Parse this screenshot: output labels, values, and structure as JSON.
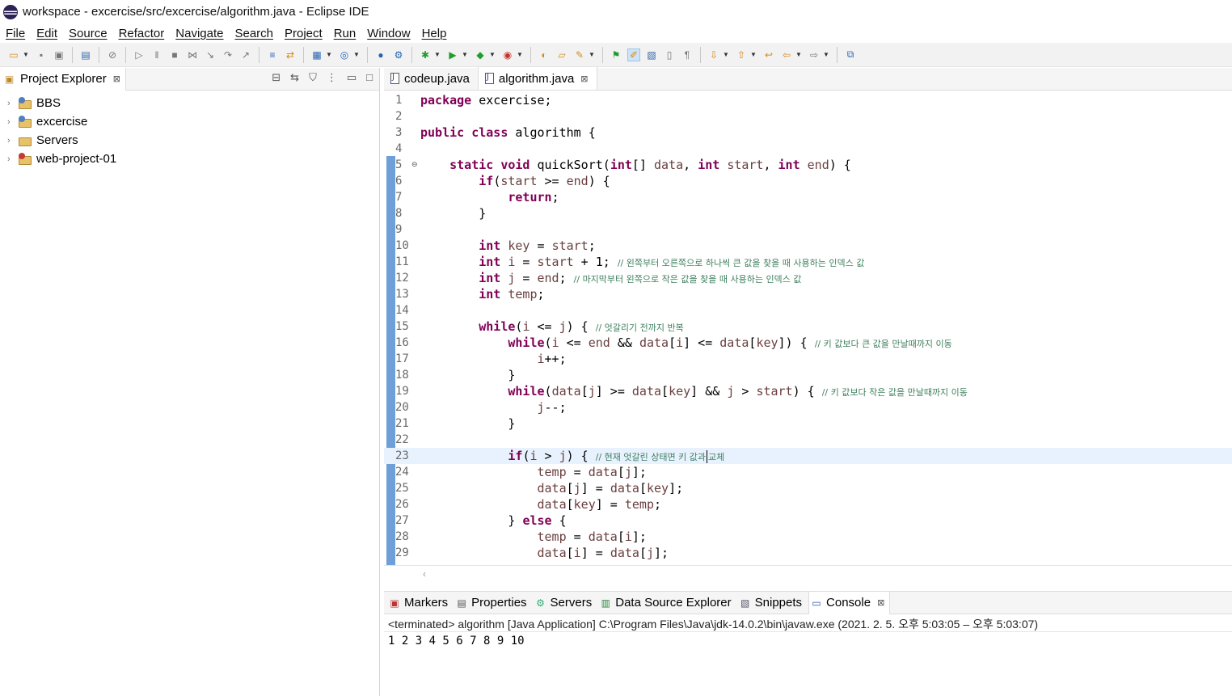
{
  "window": {
    "title": "workspace - excercise/src/excercise/algorithm.java - Eclipse IDE"
  },
  "menu": [
    "File",
    "Edit",
    "Source",
    "Refactor",
    "Navigate",
    "Search",
    "Project",
    "Run",
    "Window",
    "Help"
  ],
  "explorer": {
    "title": "Project Explorer",
    "close": "⊠",
    "projects": [
      {
        "label": "BBS",
        "badge": "java"
      },
      {
        "label": "excercise",
        "badge": "java"
      },
      {
        "label": "Servers",
        "badge": "folder"
      },
      {
        "label": "web-project-01",
        "badge": "web"
      }
    ]
  },
  "editor": {
    "tabs": [
      {
        "label": "codeup.java",
        "active": false
      },
      {
        "label": "algorithm.java",
        "active": true,
        "close": "⊠"
      }
    ],
    "current_line": 23,
    "lines": [
      {
        "n": "1",
        "fold": ""
      },
      {
        "n": "2",
        "fold": ""
      },
      {
        "n": "3",
        "fold": ""
      },
      {
        "n": "4",
        "fold": ""
      },
      {
        "n": "5",
        "fold": "⊖"
      },
      {
        "n": "6",
        "fold": ""
      },
      {
        "n": "7",
        "fold": ""
      },
      {
        "n": "8",
        "fold": ""
      },
      {
        "n": "9",
        "fold": ""
      },
      {
        "n": "10",
        "fold": ""
      },
      {
        "n": "11",
        "fold": ""
      },
      {
        "n": "12",
        "fold": ""
      },
      {
        "n": "13",
        "fold": ""
      },
      {
        "n": "14",
        "fold": ""
      },
      {
        "n": "15",
        "fold": ""
      },
      {
        "n": "16",
        "fold": ""
      },
      {
        "n": "17",
        "fold": ""
      },
      {
        "n": "18",
        "fold": ""
      },
      {
        "n": "19",
        "fold": ""
      },
      {
        "n": "20",
        "fold": ""
      },
      {
        "n": "21",
        "fold": ""
      },
      {
        "n": "22",
        "fold": ""
      },
      {
        "n": "23",
        "fold": ""
      },
      {
        "n": "24",
        "fold": ""
      },
      {
        "n": "25",
        "fold": ""
      },
      {
        "n": "26",
        "fold": ""
      },
      {
        "n": "27",
        "fold": ""
      },
      {
        "n": "28",
        "fold": ""
      },
      {
        "n": "29",
        "fold": ""
      }
    ],
    "code": {
      "l1_kw": "package",
      "l1_rest": " excercise;",
      "l3_kw1": "public",
      "l3_kw2": "class",
      "l3_rest": " algorithm {",
      "l5_kw1": "static",
      "l5_kw2": "void",
      "l5_m": " quickSort(",
      "l5_kw3": "int",
      "l5_a": "[] ",
      "l5_v1": "data",
      "l5_b": ", ",
      "l5_kw4": "int",
      "l5_c": " ",
      "l5_v2": "start",
      "l5_d": ", ",
      "l5_kw5": "int",
      "l5_e": " ",
      "l5_v3": "end",
      "l5_f": ") {",
      "l6_kw": "if",
      "l6_a": "(",
      "l6_v1": "start",
      "l6_b": " >= ",
      "l6_v2": "end",
      "l6_c": ") {",
      "l7_kw": "return",
      "l7_a": ";",
      "l8": "}",
      "l10_kw": "int",
      "l10_v1": " key",
      "l10_a": " = ",
      "l10_v2": "start",
      "l10_b": ";",
      "l11_kw": "int",
      "l11_v1": " i",
      "l11_a": " = ",
      "l11_v2": "start",
      "l11_b": " + 1; ",
      "l11_cm": "// 왼쪽부터 오른쪽으로 하나씩 큰 값을 찾을 때 사용하는 인덱스 값",
      "l12_kw": "int",
      "l12_v1": " j",
      "l12_a": " = ",
      "l12_v2": "end",
      "l12_b": "; ",
      "l12_cm": "// 마지막부터 왼쪽으로 작은 값을 찾을 때 사용하는 인덱스 값",
      "l13_kw": "int",
      "l13_v1": " temp",
      "l13_a": ";",
      "l15_kw": "while",
      "l15_a": "(",
      "l15_v1": "i",
      "l15_b": " <= ",
      "l15_v2": "j",
      "l15_c": ") { ",
      "l15_cm": "// 엇갈리기 전까지 반복",
      "l16_kw": "while",
      "l16_a": "(",
      "l16_v1": "i",
      "l16_b": " <= ",
      "l16_v2": "end",
      "l16_c": " && ",
      "l16_v3": "data",
      "l16_d": "[",
      "l16_v4": "i",
      "l16_e": "] <= ",
      "l16_v5": "data",
      "l16_f": "[",
      "l16_v6": "key",
      "l16_g": "]) { ",
      "l16_cm": "// 키 값보다 큰 값을 만날때까지 이동",
      "l17_v": "i",
      "l17_a": "++;",
      "l18": "}",
      "l19_kw": "while",
      "l19_a": "(",
      "l19_v1": "data",
      "l19_b": "[",
      "l19_v2": "j",
      "l19_c": "] >= ",
      "l19_v3": "data",
      "l19_d": "[",
      "l19_v4": "key",
      "l19_e": "] && ",
      "l19_v5": "j",
      "l19_f": " > ",
      "l19_v6": "start",
      "l19_g": ") { ",
      "l19_cm": "// 키 값보다 작은 값을 만날때까지 이동",
      "l20_v": "j",
      "l20_a": "--;",
      "l21": "}",
      "l23_kw": "if",
      "l23_a": "(",
      "l23_v1": "i",
      "l23_b": " > ",
      "l23_v2": "j",
      "l23_c": ") { ",
      "l23_cm1": "// 현재 엇갈린 상태면 키 값과",
      "l23_cm2": "교체",
      "l24_v1": "temp",
      "l24_a": " = ",
      "l24_v2": "data",
      "l24_b": "[",
      "l24_v3": "j",
      "l24_c": "];",
      "l25_v1": "data",
      "l25_a": "[",
      "l25_v2": "j",
      "l25_b": "] = ",
      "l25_v3": "data",
      "l25_c": "[",
      "l25_v4": "key",
      "l25_d": "];",
      "l26_v1": "data",
      "l26_a": "[",
      "l26_v2": "key",
      "l26_b": "] = ",
      "l26_v3": "temp",
      "l26_c": ";",
      "l27_a": "} ",
      "l27_kw": "else",
      "l27_b": " {",
      "l28_v1": "temp",
      "l28_a": " = ",
      "l28_v2": "data",
      "l28_b": "[",
      "l28_v3": "i",
      "l28_c": "];",
      "l29_v1": "data",
      "l29_a": "[",
      "l29_v2": "i",
      "l29_b": "] = ",
      "l29_v3": "data",
      "l29_c": "[",
      "l29_v4": "j",
      "l29_d": "];"
    }
  },
  "bottom_panel": {
    "tabs": [
      {
        "label": "Markers",
        "icon": "markers-icon"
      },
      {
        "label": "Properties",
        "icon": "properties-icon"
      },
      {
        "label": "Servers",
        "icon": "servers-icon"
      },
      {
        "label": "Data Source Explorer",
        "icon": "data-source-icon"
      },
      {
        "label": "Snippets",
        "icon": "snippets-icon"
      },
      {
        "label": "Console",
        "icon": "console-icon",
        "active": true,
        "close": "⊠"
      }
    ],
    "console_status": "<terminated> algorithm [Java Application] C:\\Program Files\\Java\\jdk-14.0.2\\bin\\javaw.exe  (2021. 2. 5. 오후 5:03:05 – 오후 5:03:07)",
    "console_output": "1 2 3 4 5 6 7 8 9 10"
  },
  "colors": {
    "keyword": "#7f0055",
    "variable": "#6a3e3e",
    "comment": "#3f7f5f",
    "current_line": "#e8f2fe",
    "ruler": "#6f9fd8"
  }
}
